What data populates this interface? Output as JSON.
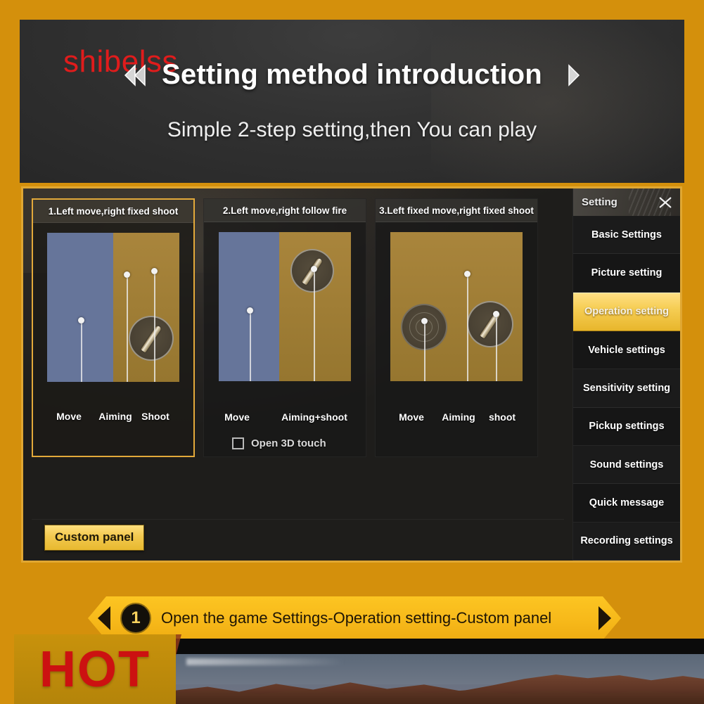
{
  "header": {
    "watermark": "shibelss",
    "title": "Setting method introduction",
    "subtitle": "Simple 2-step setting,then You can play",
    "left_chevron_icon": "double-chevron-left-icon",
    "right_chevron_icon": "double-chevron-right-icon"
  },
  "game_window": {
    "options": [
      {
        "title": "1.Left move,right fixed shoot",
        "selected": true,
        "labels": [
          "Move",
          "Aiming",
          "Shoot"
        ],
        "has_3d_touch": false
      },
      {
        "title": "2.Left move,right follow fire",
        "selected": false,
        "labels": [
          "Move",
          "Aiming+shoot"
        ],
        "has_3d_touch": true,
        "touch_label": "Open 3D touch",
        "touch_checked": false
      },
      {
        "title": "3.Left fixed move,right fixed shoot",
        "selected": false,
        "labels": [
          "Move",
          "Aiming",
          "shoot"
        ],
        "has_3d_touch": false
      }
    ],
    "custom_panel_button": "Custom panel",
    "sidebar": {
      "title": "Setting",
      "close_icon": "close-x-icon",
      "items": [
        {
          "label": "Basic Settings",
          "active": false
        },
        {
          "label": "Picture setting",
          "active": false
        },
        {
          "label": "Operation setting",
          "active": true
        },
        {
          "label": "Vehicle settings",
          "active": false
        },
        {
          "label": "Sensitivity setting",
          "active": false
        },
        {
          "label": "Pickup settings",
          "active": false
        },
        {
          "label": "Sound settings",
          "active": false
        },
        {
          "label": "Quick message",
          "active": false
        },
        {
          "label": "Recording settings",
          "active": false
        }
      ]
    }
  },
  "banner": {
    "step_number": "1",
    "text": "Open the game Settings-Operation setting-Custom panel",
    "left_arrow_icon": "triangle-left-icon",
    "right_arrow_icon": "triangle-right-icon"
  },
  "badge": {
    "hot_label": "HOT"
  },
  "colors": {
    "frame_amber": "#d4900c",
    "accent_gold": "#e8b62c",
    "highlight_gold": "#f6ce55",
    "banner_yellow": "#f7b91a",
    "watermark_red": "#e01c1c",
    "hot_red": "#cc1111",
    "panel_blue": "#66759a",
    "panel_gold": "#a9853c",
    "dark_bg": "#1b1b1b"
  }
}
